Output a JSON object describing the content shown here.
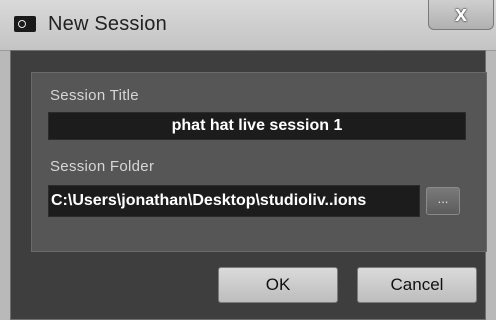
{
  "window": {
    "title": "New Session",
    "close_label": "x"
  },
  "form": {
    "session_title_label": "Session Title",
    "session_title_value": "phat hat live session 1",
    "session_folder_label": "Session Folder",
    "session_folder_value": "C:\\Users\\jonathan\\Desktop\\studioliv..ions",
    "browse_label": "..."
  },
  "buttons": {
    "ok_label": "OK",
    "cancel_label": "Cancel"
  }
}
